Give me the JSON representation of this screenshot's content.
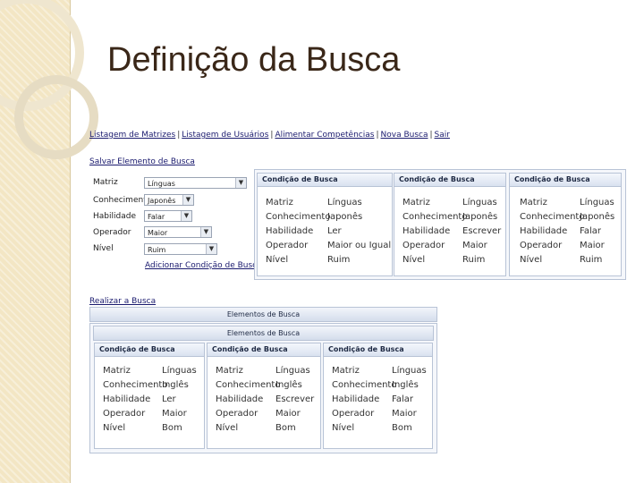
{
  "title": "Definição da Busca",
  "nav": [
    "Listagem de Matrizes",
    "Listagem de Usuários",
    "Alimentar Competências",
    "Nova Busca",
    "Sair"
  ],
  "nav_sep": "|",
  "salvar_link": "Salvar Elemento de Busca",
  "form": {
    "labels": [
      "Matriz",
      "Conhecimento",
      "Habilidade",
      "Operador",
      "Nível"
    ],
    "values": [
      "Línguas",
      "Japonês",
      "Falar",
      "Maior",
      "Ruim"
    ],
    "add_link": "Adicionar Condição de Busca"
  },
  "top_panels": [
    {
      "header": "Condição de Busca",
      "rows": [
        [
          "Matriz",
          "Línguas"
        ],
        [
          "Conhecimento",
          "Japonês"
        ],
        [
          "Habilidade",
          "Ler"
        ],
        [
          "Operador",
          "Maior ou Igual"
        ],
        [
          "Nível",
          "Ruim"
        ]
      ]
    },
    {
      "header": "Condição de Busca",
      "rows": [
        [
          "Matriz",
          "Línguas"
        ],
        [
          "Conhecimento",
          "Japonês"
        ],
        [
          "Habilidade",
          "Escrever"
        ],
        [
          "Operador",
          "Maior"
        ],
        [
          "Nível",
          "Ruim"
        ]
      ]
    },
    {
      "header": "Condição de Busca",
      "rows": [
        [
          "Matriz",
          "Línguas"
        ],
        [
          "Conhecimento",
          "Japonês"
        ],
        [
          "Habilidade",
          "Falar"
        ],
        [
          "Operador",
          "Maior"
        ],
        [
          "Nível",
          "Ruim"
        ]
      ]
    }
  ],
  "realizar_link": "Realizar a Busca",
  "bar1": "Elementos de Busca",
  "bar2": "Elementos de Busca",
  "bottom_panels": [
    {
      "header": "Condição de Busca",
      "rows": [
        [
          "Matriz",
          "Línguas"
        ],
        [
          "Conhecimento",
          "Inglês"
        ],
        [
          "Habilidade",
          "Ler"
        ],
        [
          "Operador",
          "Maior"
        ],
        [
          "Nível",
          "Bom"
        ]
      ]
    },
    {
      "header": "Condição de Busca",
      "rows": [
        [
          "Matriz",
          "Línguas"
        ],
        [
          "Conhecimento",
          "Inglês"
        ],
        [
          "Habilidade",
          "Escrever"
        ],
        [
          "Operador",
          "Maior"
        ],
        [
          "Nível",
          "Bom"
        ]
      ]
    },
    {
      "header": "Condição de Busca",
      "rows": [
        [
          "Matriz",
          "Línguas"
        ],
        [
          "Conhecimento",
          "Inglês"
        ],
        [
          "Habilidade",
          "Falar"
        ],
        [
          "Operador",
          "Maior"
        ],
        [
          "Nível",
          "Bom"
        ]
      ]
    }
  ]
}
